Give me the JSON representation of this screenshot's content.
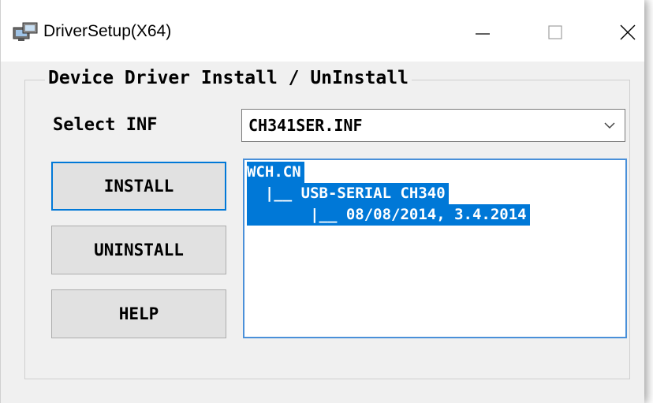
{
  "window": {
    "title": "DriverSetup(X64)",
    "controls": {
      "minimize": "minimize-icon",
      "maximize": "maximize-icon",
      "close": "close-icon"
    }
  },
  "group": {
    "label": "Device Driver Install / UnInstall"
  },
  "inf": {
    "label": "Select INF",
    "selected": "CH341SER.INF"
  },
  "buttons": {
    "install": "INSTALL",
    "uninstall": "UNINSTALL",
    "help": "HELP"
  },
  "tree": {
    "lines": [
      "WCH.CN",
      "  |__ USB-SERIAL CH340",
      "       |__ 08/08/2014, 3.4.2014"
    ]
  },
  "colors": {
    "accent": "#0078d7",
    "selection_text": "#ffffff",
    "dialog_bg": "#f0f0f0"
  }
}
